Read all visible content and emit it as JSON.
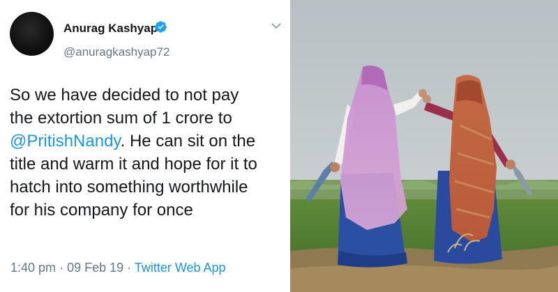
{
  "tweet": {
    "author": {
      "name": "Anurag Kashyap",
      "handle": "@anuragkashyap72",
      "verified": true
    },
    "text": {
      "line1": "So we have decided to not pay",
      "line2": "the extortion sum of 1 crore to",
      "mention": "@PritishNandy",
      "line3_rest": ". He can sit on the",
      "line4": "title and warm it and hope for it to",
      "line5": "hatch into something worthwhile",
      "line6": "for his company for once"
    },
    "meta": {
      "time": "1:40 pm",
      "separator": "·",
      "date": "09 Feb 19",
      "source": "Twitter Web App"
    }
  },
  "icons": {
    "verified": "verified-badge-icon",
    "caret": "chevron-down-icon"
  },
  "colors": {
    "text": "#14171a",
    "secondary": "#657786",
    "link": "#1b95e0",
    "verified": "#1da1f2"
  }
}
